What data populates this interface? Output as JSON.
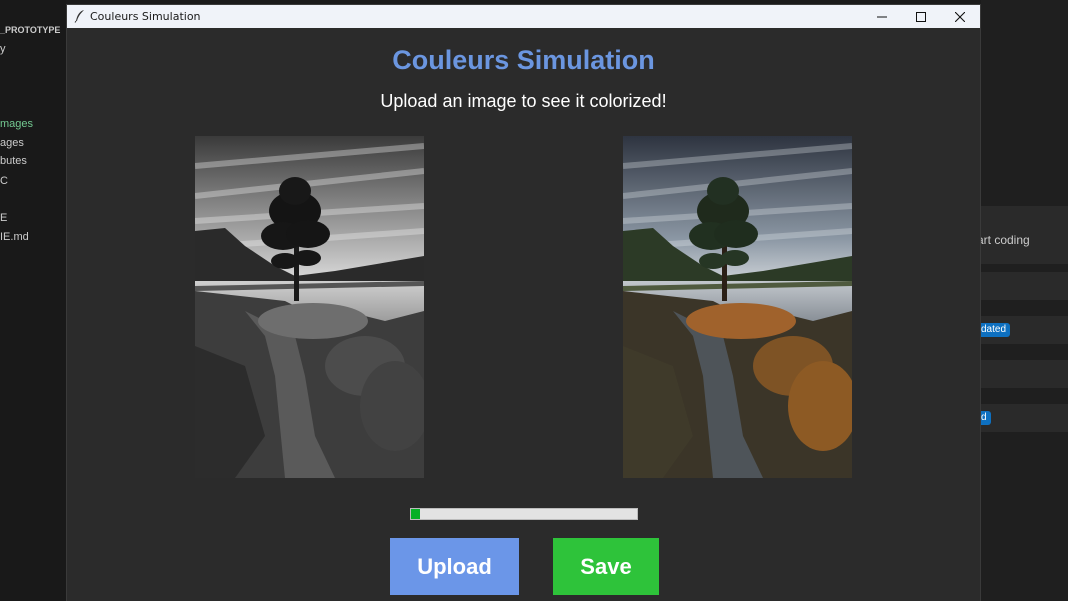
{
  "background_ide": {
    "explorer_items": [
      {
        "label": "_PROTOTYPE",
        "style": "bold"
      },
      {
        "label": "y",
        "style": "normal"
      },
      {
        "label": "mages",
        "style": "green"
      },
      {
        "label": "ages",
        "style": "normal"
      },
      {
        "label": "butes",
        "style": "normal"
      },
      {
        "label": "C",
        "style": "normal"
      },
      {
        "label": "E",
        "style": "normal"
      },
      {
        "label": "IE.md",
        "style": "normal"
      }
    ],
    "right_panel": {
      "start_coding_text": "art coding",
      "badge_updated": "dated",
      "badge_second": "d"
    }
  },
  "window": {
    "title": "Couleurs Simulation",
    "controls": {
      "minimize": "minimize-icon",
      "maximize": "maximize-icon",
      "close": "close-icon"
    }
  },
  "app": {
    "heading": "Couleurs Simulation",
    "subheading": "Upload an image to see it colorized!",
    "progress_fraction": 0.04,
    "upload_label": "Upload",
    "save_label": "Save"
  },
  "colors": {
    "heading": "#6b96e0",
    "upload_button": "#6b96e8",
    "save_button": "#2ec33a",
    "progress_fill": "#06b025"
  }
}
